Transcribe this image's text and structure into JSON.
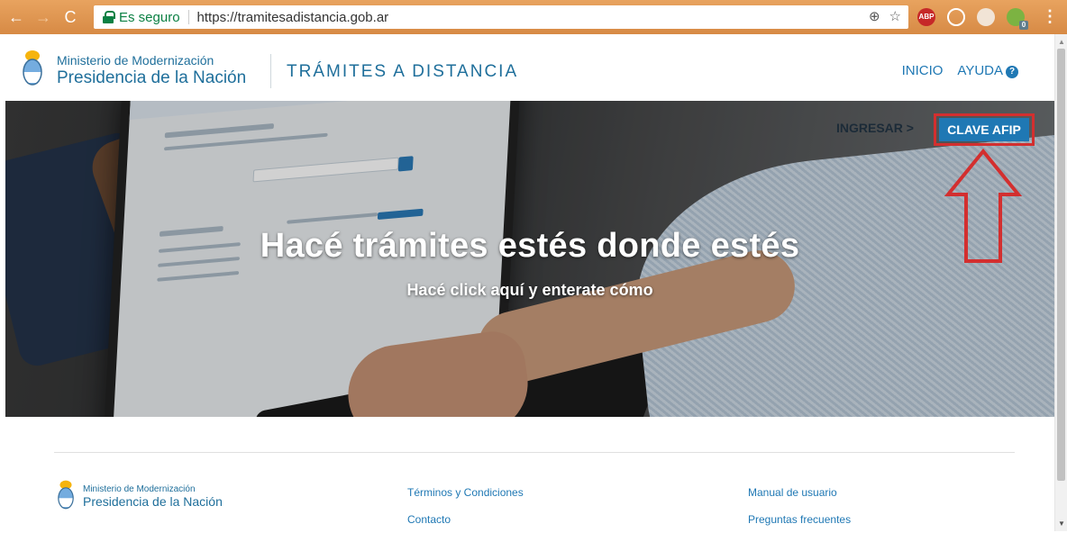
{
  "browser": {
    "secure_label": "Es seguro",
    "url": "https://tramitesadistancia.gob.ar",
    "extensions": [
      {
        "name": "abp",
        "label": "ABP"
      }
    ]
  },
  "header": {
    "ministry_line1": "Ministerio de Modernización",
    "ministry_line2": "Presidencia de la Nación",
    "site_title": "TRÁMITES A DISTANCIA",
    "nav": {
      "inicio": "INICIO",
      "ayuda": "AYUDA"
    }
  },
  "hero": {
    "title": "Hacé trámites estés donde estés",
    "subtitle": "Hacé click aquí y enterate cómo",
    "ingresar": "INGRESAR >",
    "afip_button": "CLAVE AFIP"
  },
  "footer": {
    "ministry_line1": "Ministerio de Modernización",
    "ministry_line2": "Presidencia de la Nación",
    "links_col1": [
      "Términos y Condiciones",
      "Contacto"
    ],
    "links_col2": [
      "Manual de usuario",
      "Preguntas frecuentes"
    ]
  },
  "colors": {
    "primary": "#1f78b4",
    "highlight": "#d32f2f",
    "chrome": "#d78a45"
  }
}
